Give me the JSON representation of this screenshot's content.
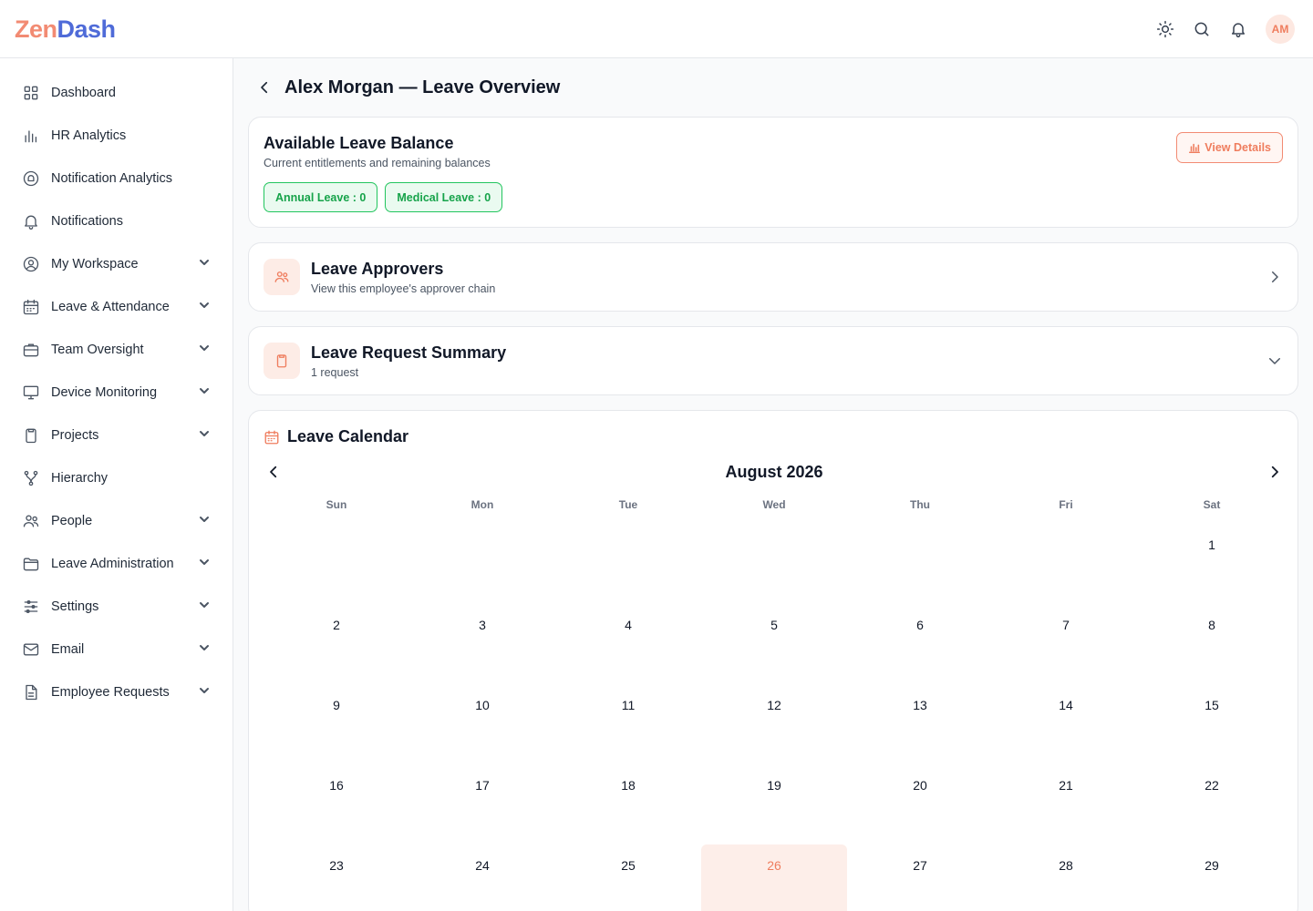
{
  "brand": {
    "part1": "Zen",
    "part2": "Dash"
  },
  "header": {
    "avatar_initials": "AM"
  },
  "sidebar": {
    "items": [
      {
        "label": "Dashboard",
        "icon": "grid-icon",
        "expandable": false
      },
      {
        "label": "HR Analytics",
        "icon": "bar-chart-icon",
        "expandable": false
      },
      {
        "label": "Notification Analytics",
        "icon": "bell-circle-icon",
        "expandable": false
      },
      {
        "label": "Notifications",
        "icon": "bell-icon",
        "expandable": false
      },
      {
        "label": "My Workspace",
        "icon": "user-circle-icon",
        "expandable": true
      },
      {
        "label": "Leave & Attendance",
        "icon": "calendar-icon",
        "expandable": true
      },
      {
        "label": "Team Oversight",
        "icon": "briefcase-icon",
        "expandable": true
      },
      {
        "label": "Device Monitoring",
        "icon": "monitor-icon",
        "expandable": true
      },
      {
        "label": "Projects",
        "icon": "clipboard-icon",
        "expandable": true
      },
      {
        "label": "Hierarchy",
        "icon": "hierarchy-icon",
        "expandable": false
      },
      {
        "label": "People",
        "icon": "users-icon",
        "expandable": true
      },
      {
        "label": "Leave Administration",
        "icon": "folder-icon",
        "expandable": true
      },
      {
        "label": "Settings",
        "icon": "sliders-icon",
        "expandable": true
      },
      {
        "label": "Email",
        "icon": "mail-icon",
        "expandable": true
      },
      {
        "label": "Employee Requests",
        "icon": "document-icon",
        "expandable": true
      }
    ]
  },
  "page": {
    "title": "Alex Morgan — Leave Overview"
  },
  "balance": {
    "title": "Available Leave Balance",
    "subtitle": "Current entitlements and remaining balances",
    "view_details": "View Details",
    "chips": [
      "Annual Leave : 0",
      "Medical Leave : 0"
    ]
  },
  "approvers": {
    "title": "Leave Approvers",
    "subtitle": "View this employee's approver chain"
  },
  "summary": {
    "title": "Leave Request Summary",
    "subtitle": "1 request"
  },
  "calendar": {
    "title": "Leave Calendar",
    "month": "August 2026",
    "weekdays": [
      "Sun",
      "Mon",
      "Tue",
      "Wed",
      "Thu",
      "Fri",
      "Sat"
    ],
    "leading_blanks": 6,
    "visible_days": 29,
    "highlighted_day": 26
  },
  "colors": {
    "accent": "#ef7d5e",
    "success": "#16a34a",
    "brand_blue": "#4f6bd8"
  }
}
